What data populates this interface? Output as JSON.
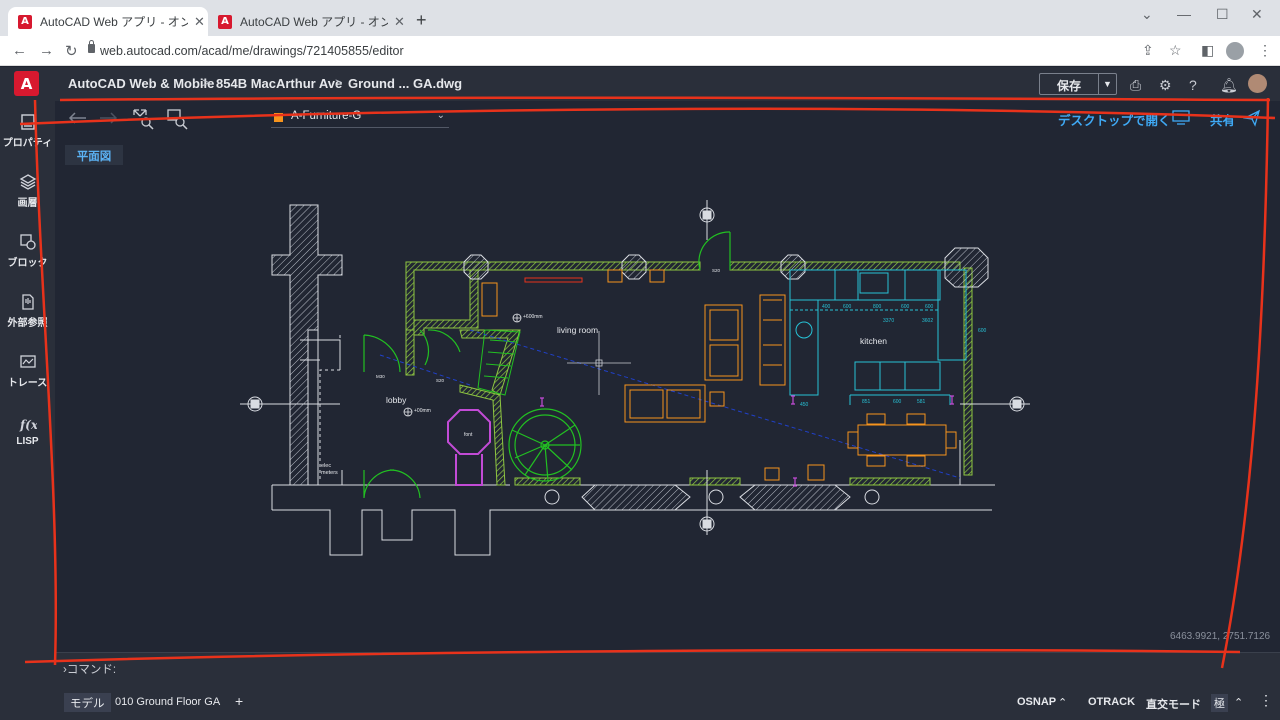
{
  "browser": {
    "tabs": [
      {
        "icon": "A",
        "label": "AutoCAD Web アプリ - オンライン C",
        "close": "✕"
      },
      {
        "icon": "A",
        "label": "AutoCAD Web アプリ - オンライン C",
        "close": "✕"
      }
    ],
    "new_tab": "+",
    "url": "web.autocad.com/acad/me/drawings/721405855/editor"
  },
  "header": {
    "logo": "A",
    "breadcrumb": [
      "AutoCAD Web & Mobile",
      "854B MacArthur Ave",
      "Ground ... GA.dwg"
    ],
    "separator": ">",
    "save_label": "保存"
  },
  "sidebar": {
    "items": [
      {
        "label": "プロパティ",
        "icon": "properties-icon"
      },
      {
        "label": "画層",
        "icon": "layers-icon"
      },
      {
        "label": "ブロック",
        "icon": "block-icon"
      },
      {
        "label": "外部参照",
        "icon": "xref-icon"
      },
      {
        "label": "トレース",
        "icon": "trace-icon"
      },
      {
        "label": "LISP",
        "icon": "lisp-icon"
      }
    ]
  },
  "toolbar": {
    "layer_name": "A-Furniture-G",
    "layer_color": "#f7941d",
    "open_desktop": "デスクトップで開く",
    "share": "共有"
  },
  "canvas": {
    "view_tag": "平面図",
    "coords": "6463.9921, 2751.7126",
    "labels": {
      "living": "living room",
      "kitchen": "kitchen",
      "lobby": "lobby",
      "elec": "elec",
      "meters": "meters",
      "font": "font",
      "dim1": "+600mm",
      "dim2": "+00mm",
      "m30": "M30",
      "s20": "S20",
      "s20b": "S20",
      "k_a": "400",
      "k_b": "600",
      "k_c": "800",
      "k_d": "600",
      "k_e": "600",
      "k_f": "3370",
      "k_g": "3602",
      "k_h": "851",
      "k_i": "600",
      "k_j": "581",
      "k_k": "450",
      "k_l": "600"
    }
  },
  "command": {
    "prompt": "›コマンド:"
  },
  "status": {
    "model_tab": "モデル",
    "layout_name": "010 Ground Floor GA",
    "add": "+",
    "osnap": "OSNAP",
    "otrack": "OTRACK",
    "ortho": "直交モード",
    "polar": "極"
  },
  "colors": {
    "accent": "#3fa9f5",
    "brand": "#d7192f",
    "wall": "#8ec641",
    "furniture": "#f7941d",
    "kitchen": "#27c2d6",
    "green": "#22c022",
    "magenta": "#c24bd6",
    "annotation": "#e8321b"
  }
}
